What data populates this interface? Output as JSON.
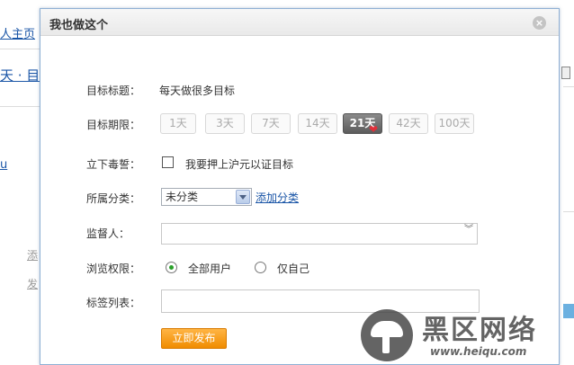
{
  "background": {
    "link_profile": "人主页",
    "link_day": "天 · 目",
    "link_u": "u",
    "text_add": "添",
    "text_fa": "发"
  },
  "dialog": {
    "title": "我也做这个",
    "close_symbol": "×",
    "goal_title_label": "目标标题：",
    "goal_title_value": "每天做很多目标",
    "period_label": "目标期限：",
    "periods": [
      "1天",
      "3天",
      "7天",
      "14天",
      "21天",
      "42天",
      "100天"
    ],
    "selected_period": "21天",
    "oath_label": "立下毒誓：",
    "oath_text": "我要押上沪元以证目标",
    "category_label": "所属分类：",
    "category_selected": "未分类",
    "add_category": "添加分类",
    "supervisor_label": "监督人：",
    "privacy_label": "浏览权限：",
    "privacy_options": [
      "全部用户",
      "仅自己"
    ],
    "privacy_selected": "全部用户",
    "tags_label": "标签列表：",
    "publish_button": "立即发布"
  },
  "watermark": {
    "title": "黑区网络",
    "url": "www.heiqu.com"
  },
  "colors": {
    "accent_orange": "#f08c00",
    "link_blue": "#1b56a7",
    "border_blue": "#8fb0d4"
  }
}
